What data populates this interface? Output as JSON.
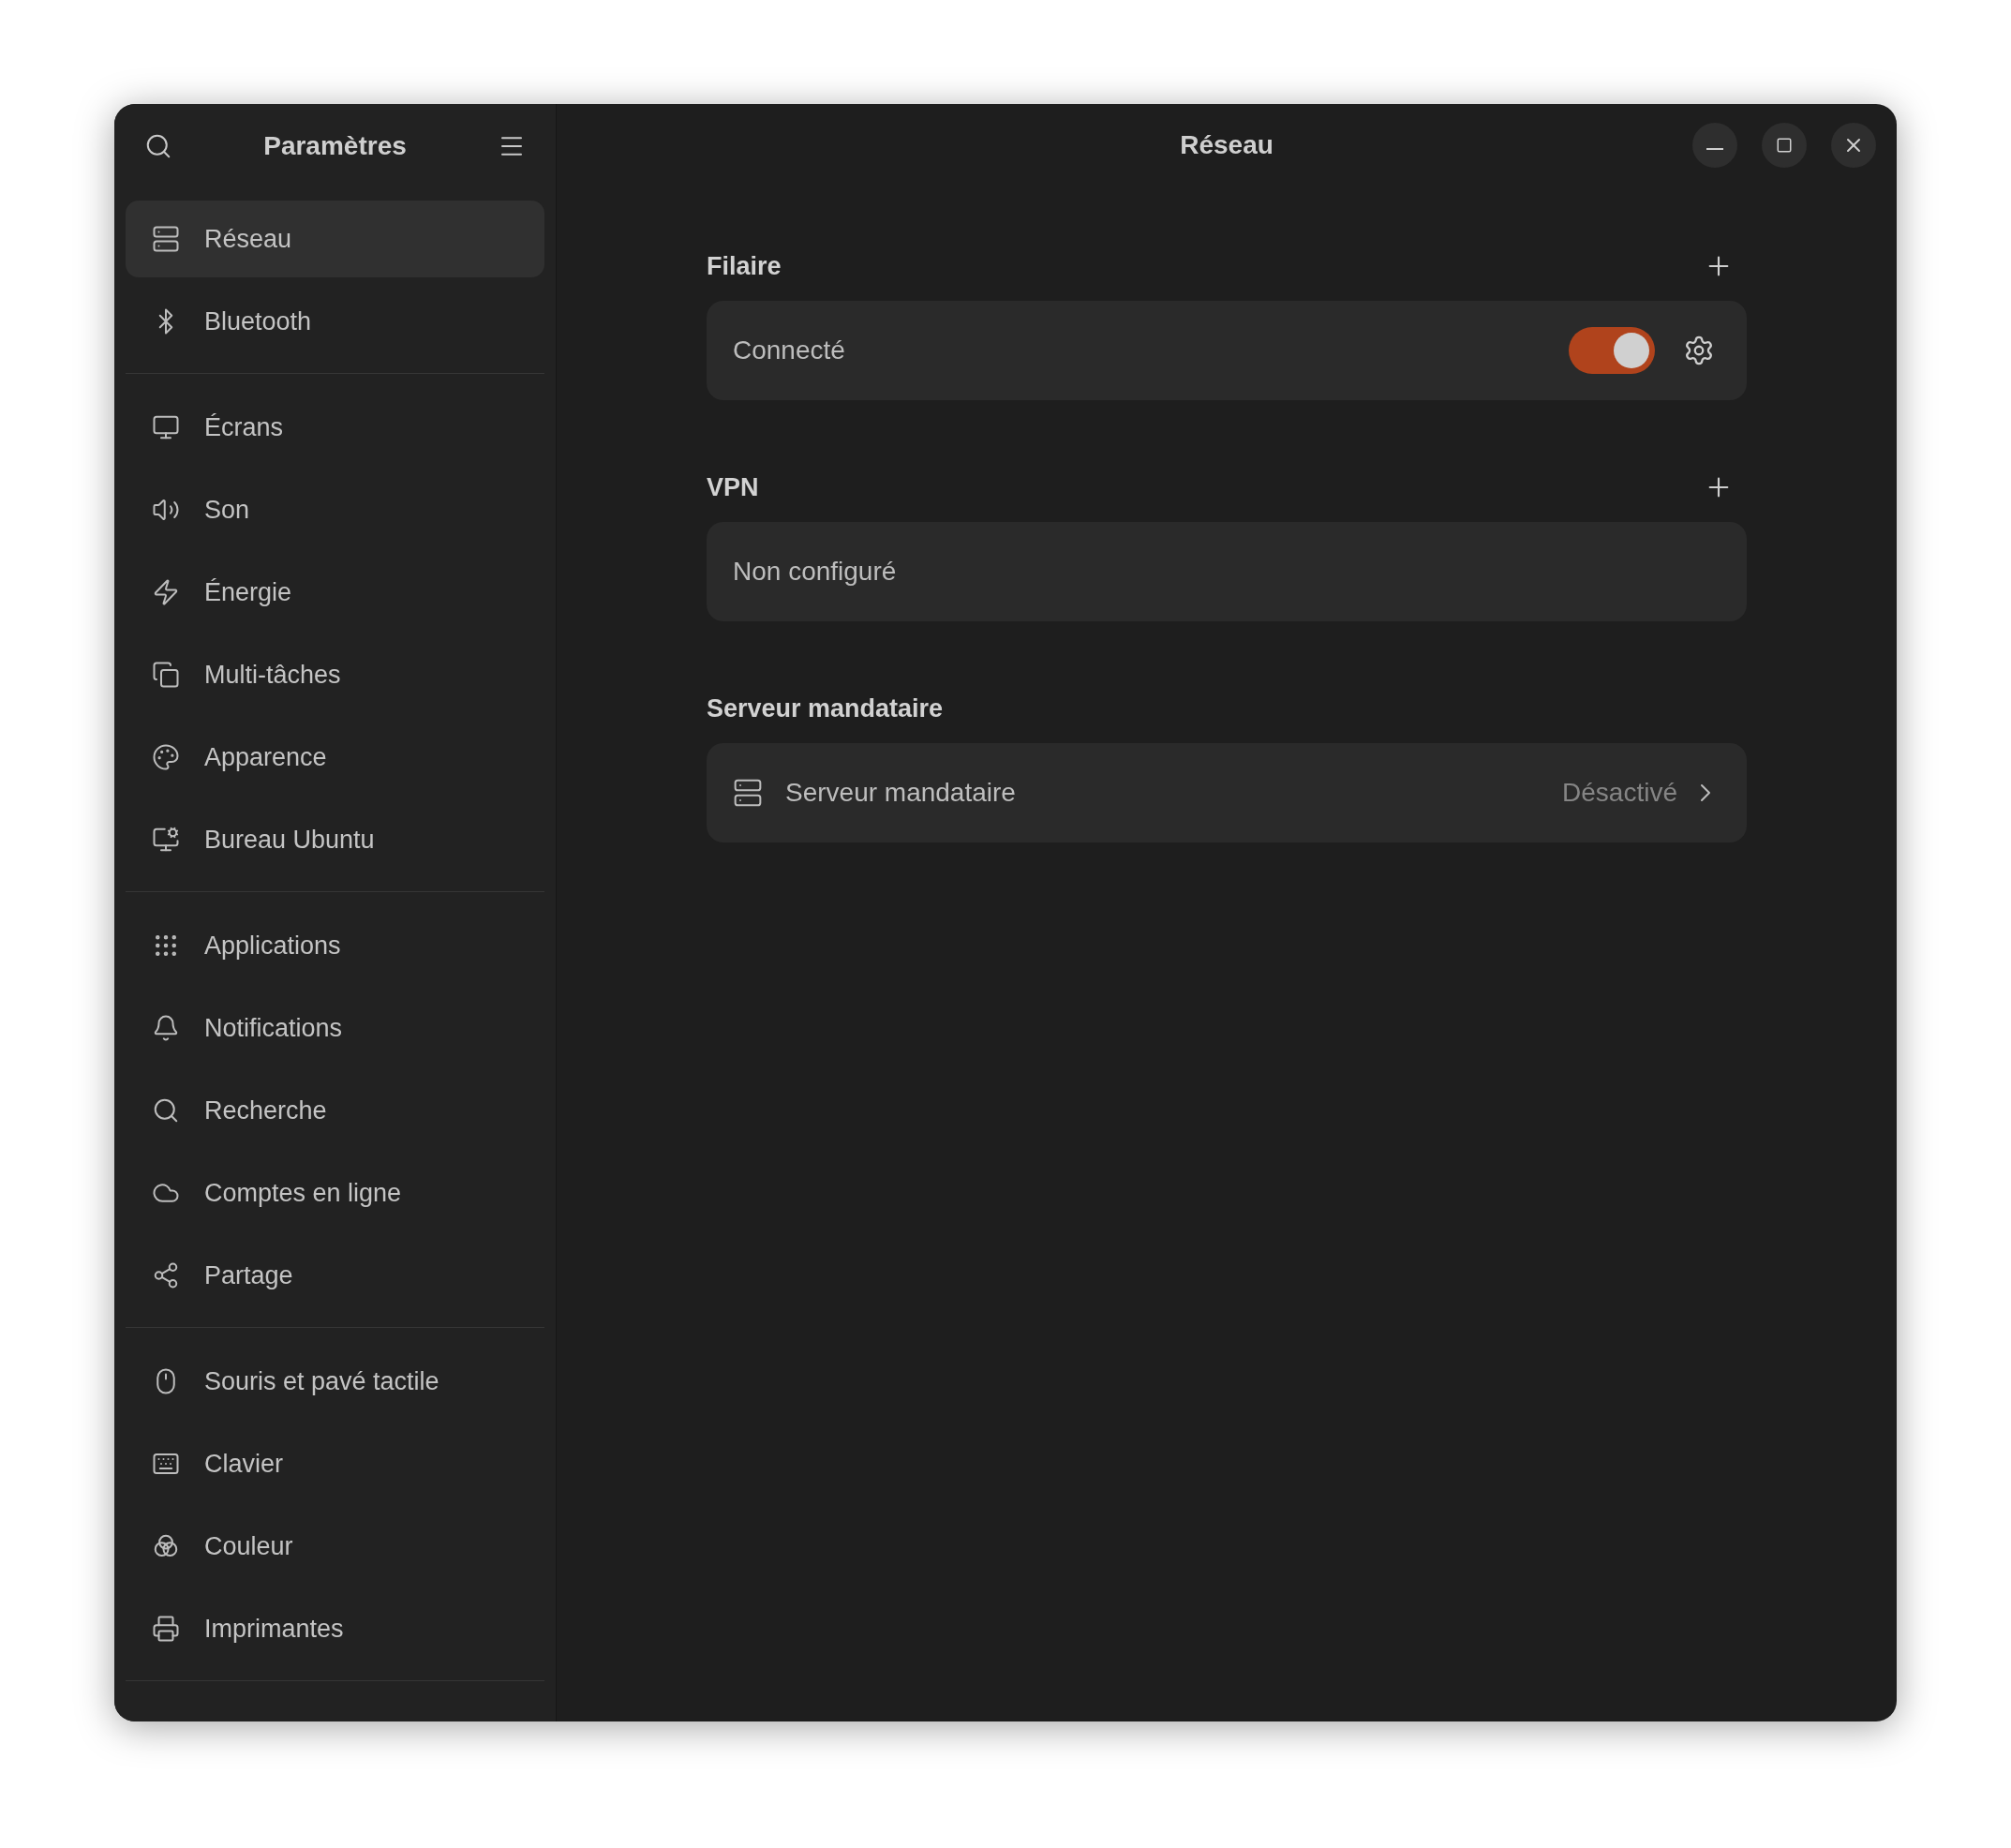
{
  "sidebar": {
    "title": "Paramètres",
    "groups": [
      [
        {
          "label": "Réseau",
          "selected": true
        },
        {
          "label": "Bluetooth",
          "selected": false
        }
      ],
      [
        {
          "label": "Écrans",
          "selected": false
        },
        {
          "label": "Son",
          "selected": false
        },
        {
          "label": "Énergie",
          "selected": false
        },
        {
          "label": "Multi-tâches",
          "selected": false
        },
        {
          "label": "Apparence",
          "selected": false
        },
        {
          "label": "Bureau Ubuntu",
          "selected": false
        }
      ],
      [
        {
          "label": "Applications",
          "selected": false
        },
        {
          "label": "Notifications",
          "selected": false
        },
        {
          "label": "Recherche",
          "selected": false
        },
        {
          "label": "Comptes en ligne",
          "selected": false
        },
        {
          "label": "Partage",
          "selected": false
        }
      ],
      [
        {
          "label": "Souris et pavé tactile",
          "selected": false
        },
        {
          "label": "Clavier",
          "selected": false
        },
        {
          "label": "Couleur",
          "selected": false
        },
        {
          "label": "Imprimantes",
          "selected": false
        }
      ]
    ]
  },
  "main": {
    "title": "Réseau",
    "sections": [
      {
        "heading": "Filaire",
        "add_button": true,
        "row": {
          "kind": "toggle",
          "label": "Connecté",
          "on": true
        }
      },
      {
        "heading": "VPN",
        "add_button": true,
        "row": {
          "kind": "placeholder",
          "label": "Non configuré"
        }
      },
      {
        "heading": "Serveur mandataire",
        "add_button": false,
        "row": {
          "kind": "link",
          "label": "Serveur mandataire",
          "value": "Désactivé"
        }
      }
    ]
  }
}
